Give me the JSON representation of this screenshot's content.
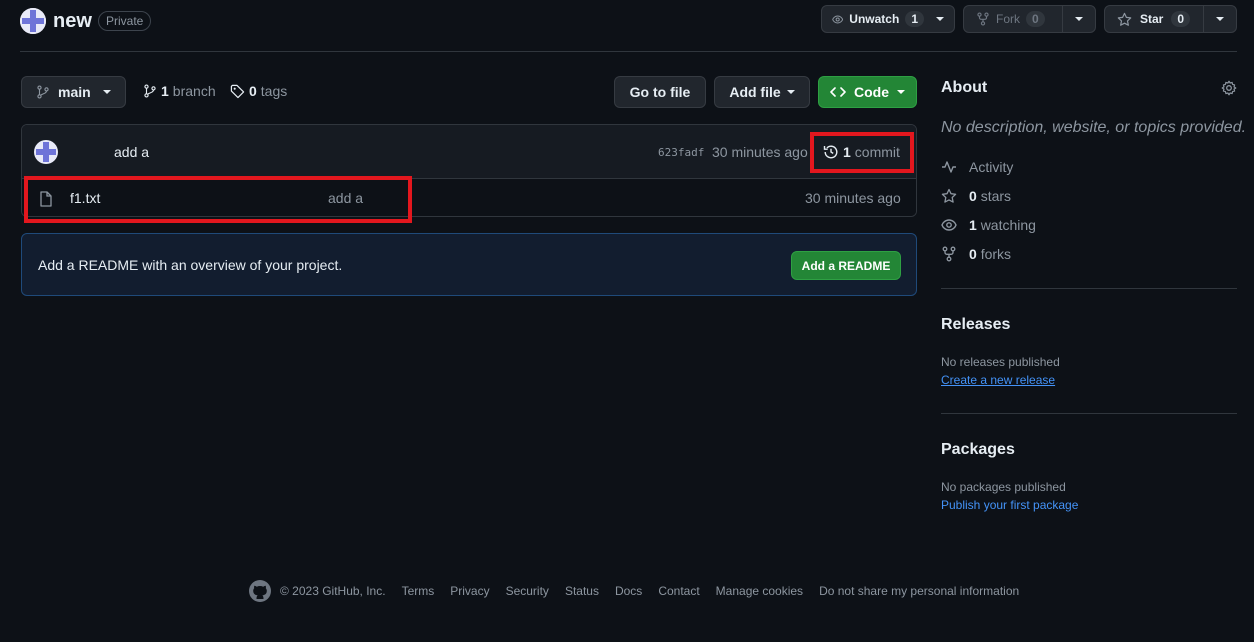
{
  "repo": {
    "name": "new",
    "visibility": "Private"
  },
  "actions": {
    "unwatch_label": "Unwatch",
    "watch_count": "1",
    "fork_label": "Fork",
    "fork_count": "0",
    "star_label": "Star",
    "star_count": "0"
  },
  "toolbar": {
    "branch_label": "main",
    "branch_count": "1",
    "branch_text": "branch",
    "tag_count": "0",
    "tag_text": "tags",
    "goto_file_label": "Go to file",
    "add_file_label": "Add file",
    "code_label": "Code"
  },
  "latest_commit": {
    "message": "add a",
    "hash": "623fadf",
    "time": "30 minutes ago",
    "commit_count": "1",
    "commit_text": "commit"
  },
  "files": [
    {
      "name": "f1.txt",
      "message": "add a",
      "time": "30 minutes ago"
    }
  ],
  "readme_banner": {
    "text": "Add a README with an overview of your project.",
    "button_label": "Add a README"
  },
  "about": {
    "title": "About",
    "description": "No description, website, or topics provided.",
    "activity_label": "Activity",
    "stars_count": "0",
    "stars_text": "stars",
    "watching_count": "1",
    "watching_text": "watching",
    "forks_count": "0",
    "forks_text": "forks"
  },
  "releases": {
    "title": "Releases",
    "empty_text": "No releases published",
    "link_text": "Create a new release"
  },
  "packages": {
    "title": "Packages",
    "empty_text": "No packages published",
    "link_text": "Publish your first package"
  },
  "footer": {
    "copyright": "© 2023 GitHub, Inc.",
    "links": [
      "Terms",
      "Privacy",
      "Security",
      "Status",
      "Docs",
      "Contact",
      "Manage cookies",
      "Do not share my personal information"
    ]
  },
  "colors": {
    "background": "#0d1117",
    "primary_green": "#238636",
    "link_blue": "#4493f8",
    "highlight_red": "#e3171e"
  }
}
